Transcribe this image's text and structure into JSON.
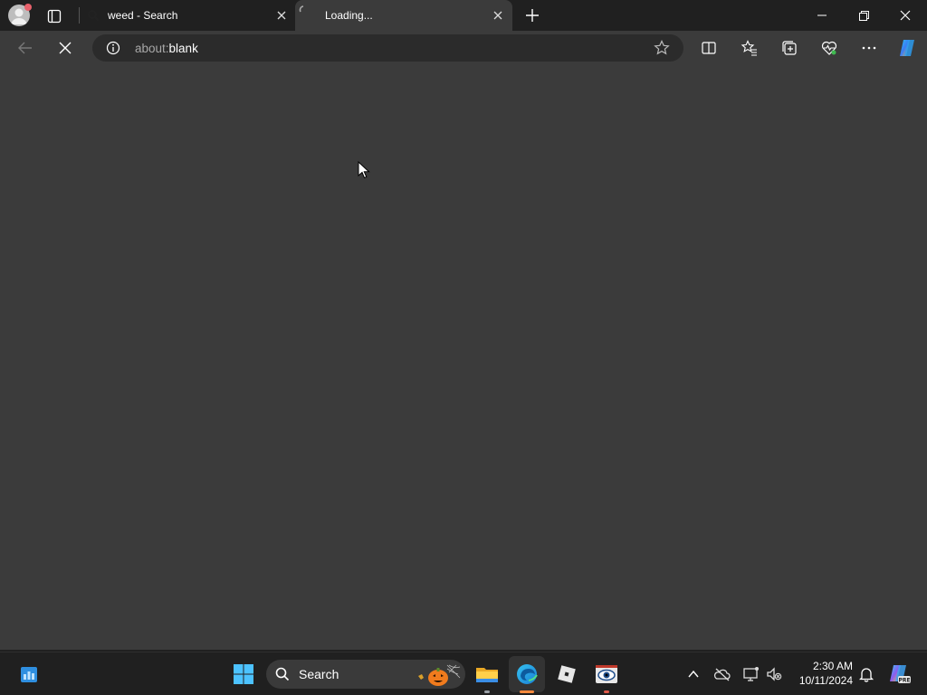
{
  "browser": {
    "tabs": [
      {
        "title": "weed - Search"
      },
      {
        "title": "Loading..."
      }
    ],
    "address": {
      "scheme": "about:",
      "path": "blank"
    }
  },
  "taskbar": {
    "search_label": "Search",
    "clock": {
      "time": "2:30 AM",
      "date": "10/11/2024"
    }
  }
}
